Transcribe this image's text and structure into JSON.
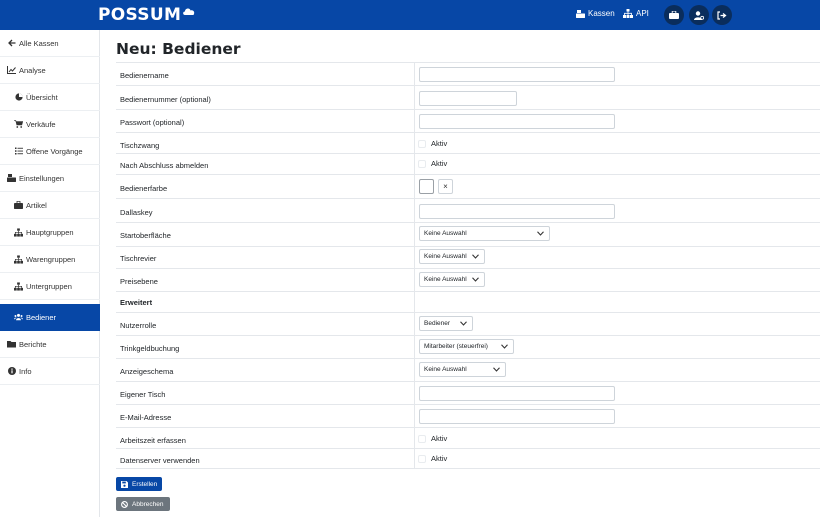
{
  "brand": {
    "name": "POSSUM"
  },
  "topnav": {
    "kassen_label": "Kassen",
    "api_label": "API"
  },
  "sidebar": {
    "items": [
      {
        "label": "Alle Kassen",
        "icon": "arrow-left-icon"
      },
      {
        "label": "Analyse",
        "icon": "chart-line-icon"
      },
      {
        "label": "Übersicht",
        "icon": "pie-chart-icon"
      },
      {
        "label": "Verkäufe",
        "icon": "cart-icon"
      },
      {
        "label": "Offene Vorgänge",
        "icon": "list-icon"
      },
      {
        "label": "Einstellungen",
        "icon": "cash-register-icon"
      },
      {
        "label": "Artikel",
        "icon": "briefcase-icon"
      },
      {
        "label": "Hauptgruppen",
        "icon": "sitemap-icon"
      },
      {
        "label": "Warengruppen",
        "icon": "sitemap-icon"
      },
      {
        "label": "Untergruppen",
        "icon": "sitemap-icon"
      },
      {
        "label": "Bediener",
        "icon": "users-icon"
      },
      {
        "label": "Berichte",
        "icon": "folder-icon"
      },
      {
        "label": "Info",
        "icon": "info-icon"
      }
    ]
  },
  "page": {
    "title": "Neu: Bediener"
  },
  "form": {
    "bedienername": {
      "label": "Bedienername",
      "value": ""
    },
    "bedienernummer": {
      "label": "Bedienernummer (optional)",
      "value": ""
    },
    "passwort": {
      "label": "Passwort (optional)",
      "value": ""
    },
    "tischzwang": {
      "label": "Tischzwang",
      "option": "Aktiv",
      "checked": false
    },
    "abmelden": {
      "label": "Nach Abschluss abmelden",
      "option": "Aktiv",
      "checked": false
    },
    "bedienerfarbe": {
      "label": "Bedienerfarbe",
      "clear": "×"
    },
    "dallaskey": {
      "label": "Dallaskey",
      "value": ""
    },
    "startoberflaeche": {
      "label": "Startoberfläche",
      "selected": "Keine Auswahl"
    },
    "tischrevier": {
      "label": "Tischrevier",
      "selected": "Keine Auswahl"
    },
    "preisebene": {
      "label": "Preisebene",
      "selected": "Keine Auswahl"
    },
    "erweitert": {
      "label": "Erweitert"
    },
    "nutzerrolle": {
      "label": "Nutzerrolle",
      "selected": "Bediener"
    },
    "trinkgeld": {
      "label": "Trinkgeldbuchung",
      "selected": "Mitarbeiter (steuerfrei)"
    },
    "anzeigeschema": {
      "label": "Anzeigeschema",
      "selected": "Keine Auswahl"
    },
    "eigener_tisch": {
      "label": "Eigener Tisch",
      "value": ""
    },
    "email": {
      "label": "E-Mail-Adresse",
      "value": ""
    },
    "arbeitszeit": {
      "label": "Arbeitszeit erfassen",
      "option": "Aktiv",
      "checked": false
    },
    "datenserver": {
      "label": "Datenserver verwenden",
      "option": "Aktiv",
      "checked": false
    }
  },
  "actions": {
    "create_label": "Erstellen",
    "cancel_label": "Abbrechen"
  },
  "colors": {
    "primary": "#0747a6",
    "secondary": "#6c757d",
    "round_button": "#0a2d5c"
  }
}
